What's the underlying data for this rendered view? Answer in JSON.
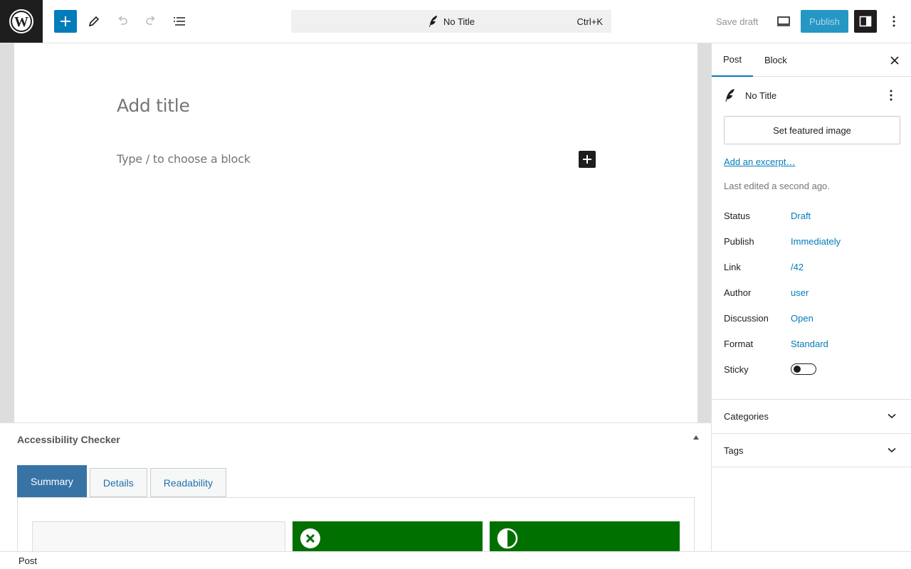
{
  "topbar": {
    "cmd_title": "No Title",
    "cmd_shortcut": "Ctrl+K",
    "save_draft": "Save draft",
    "publish": "Publish"
  },
  "editor": {
    "title_placeholder": "Add title",
    "block_placeholder": "Type / to choose a block"
  },
  "metabox": {
    "title": "Accessibility Checker",
    "tabs": [
      {
        "label": "Summary",
        "active": true
      },
      {
        "label": "Details",
        "active": false
      },
      {
        "label": "Readability",
        "active": false
      }
    ],
    "card_color": "#007000"
  },
  "sidebar": {
    "tabs": [
      {
        "label": "Post",
        "active": true
      },
      {
        "label": "Block",
        "active": false
      }
    ],
    "post_title": "No Title",
    "featured_image": "Set featured image",
    "excerpt_link": "Add an excerpt…",
    "last_edited": "Last edited a second ago.",
    "properties": [
      {
        "label": "Status",
        "value": "Draft"
      },
      {
        "label": "Publish",
        "value": "Immediately"
      },
      {
        "label": "Link",
        "value": "/42"
      },
      {
        "label": "Author",
        "value": "user"
      },
      {
        "label": "Discussion",
        "value": "Open"
      },
      {
        "label": "Format",
        "value": "Standard"
      }
    ],
    "sticky_label": "Sticky",
    "sticky_on": false,
    "panels": [
      "Categories",
      "Tags"
    ]
  },
  "footer": {
    "breadcrumb": "Post"
  },
  "colors": {
    "accent": "#007cba",
    "dark": "#1e1e1e"
  }
}
